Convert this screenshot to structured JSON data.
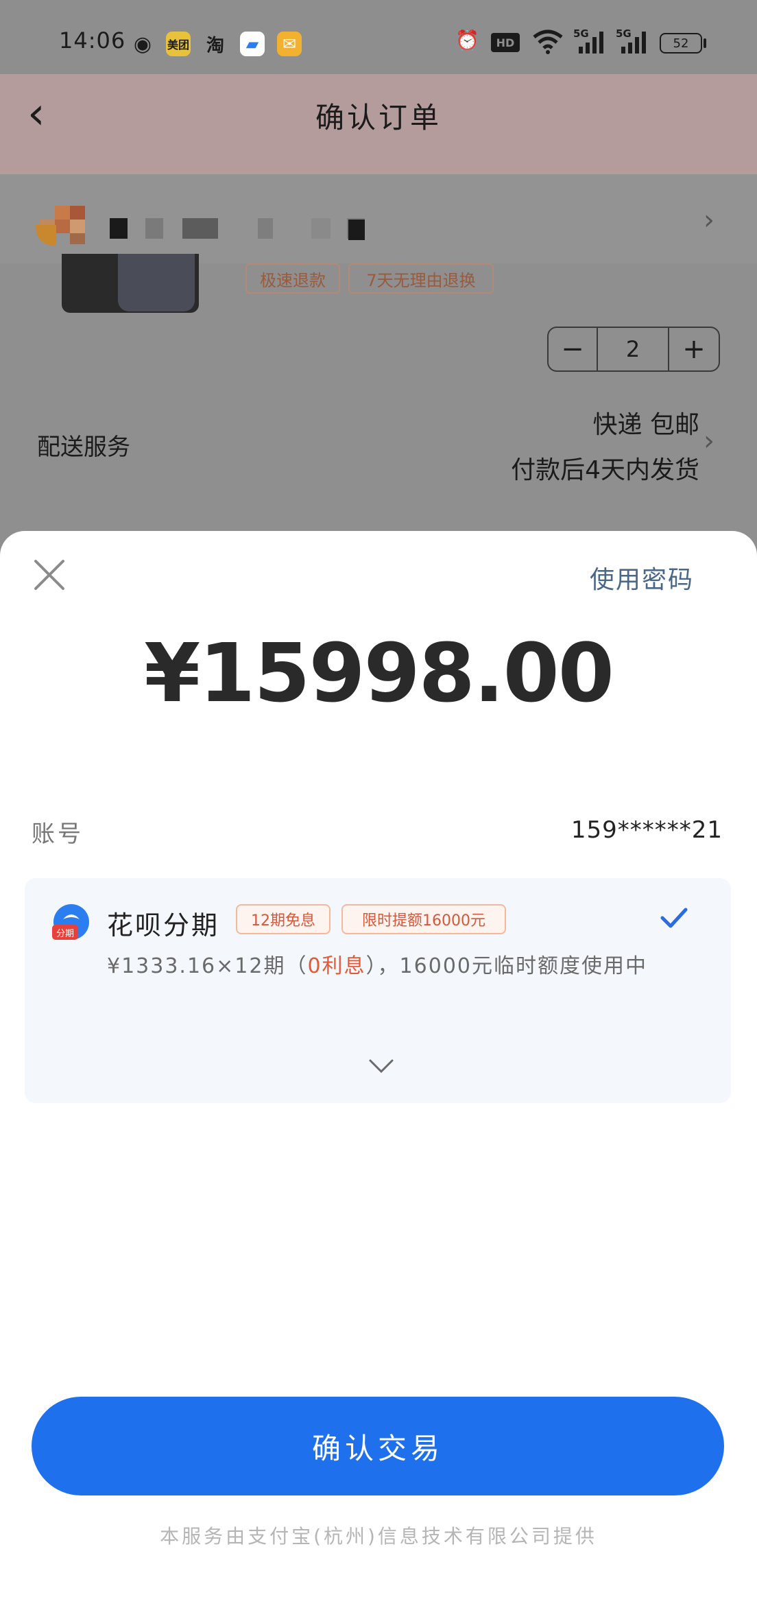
{
  "status_bar": {
    "time": "14:06",
    "app_icons": [
      {
        "name": "wechat-icon",
        "glyph": "◉"
      },
      {
        "name": "meituan-icon",
        "label": "美团"
      },
      {
        "name": "taobao-icon",
        "label": "淘"
      },
      {
        "name": "blue-app-icon",
        "glyph": "▰"
      },
      {
        "name": "mail-icon",
        "glyph": "✉"
      }
    ],
    "hd": "HD",
    "net1": "5G",
    "net2": "5G",
    "battery": "52"
  },
  "header": {
    "title": "确认订单",
    "back_glyph": "‹"
  },
  "order": {
    "tags": [
      "极速退款",
      "7天无理由退换"
    ],
    "quantity": "2",
    "minus": "−",
    "plus": "+",
    "delivery_label": "配送服务",
    "delivery_line1": "快递 包邮",
    "delivery_line2": "付款后4天内发货"
  },
  "payment": {
    "use_password": "使用密码",
    "amount": "¥15998.00",
    "account_label": "账号",
    "account_value": "159******21",
    "method_name": "花呗分期",
    "method_tags": [
      "12期免息",
      "限时提额16000元"
    ],
    "logo_badge": "分期",
    "desc_prefix": "¥1333.16×12期（",
    "desc_highlight": "0利息",
    "desc_suffix": "），16000元临时额度使用中",
    "confirm_label": "确认交易",
    "footer": "本服务由支付宝(杭州)信息技术有限公司提供"
  },
  "colors": {
    "primary_button": "#1e70ec",
    "check": "#2c6be0",
    "highlight": "#e05a3a",
    "overlay": "#8f8f8f"
  }
}
